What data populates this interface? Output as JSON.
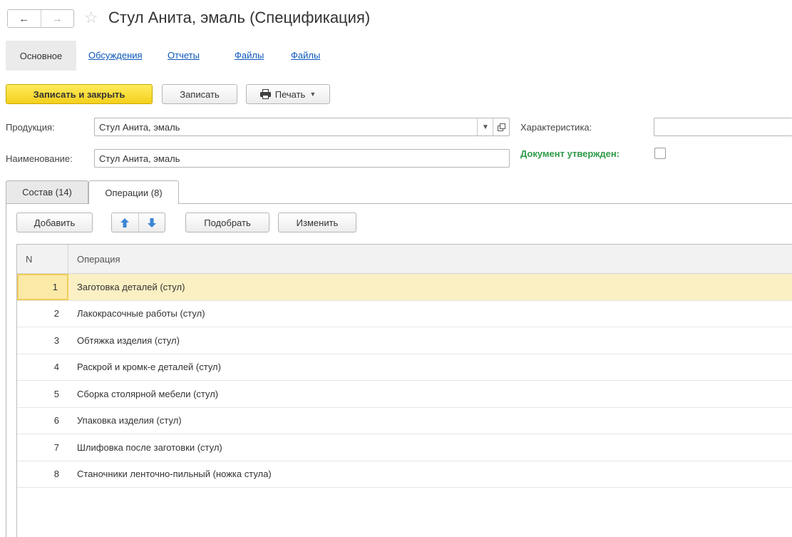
{
  "window": {
    "title": "Стул Анита, эмаль (Спецификация)",
    "nav_back": "←",
    "nav_forward": "→",
    "star": "☆"
  },
  "sections": [
    {
      "label": "Основное",
      "active": true
    },
    {
      "label": "Обсуждения"
    },
    {
      "label": "Отчеты"
    },
    {
      "label": "Файлы"
    },
    {
      "label": "Файлы"
    }
  ],
  "toolbar": {
    "save_close_label": "Записать и закрыть",
    "save_label": "Записать",
    "print_label": "Печать"
  },
  "form": {
    "product_label": "Продукция:",
    "product_value": "Стул Анита, эмаль",
    "characteristic_label": "Характеристика:",
    "characteristic_value": "",
    "name_label": "Наименование:",
    "name_value": "Стул Анита, эмаль",
    "approved_label": "Документ утвержден:",
    "approved_checked": false
  },
  "tabs": [
    {
      "label": "Состав (14)"
    },
    {
      "label": "Операции (8)",
      "active": true
    }
  ],
  "table_toolbar": {
    "add_label": "Добавить",
    "pick_label": "Подобрать",
    "edit_label": "Изменить"
  },
  "table": {
    "columns": [
      "N",
      "Операция"
    ],
    "rows": [
      {
        "n": "1",
        "operation": "Заготовка деталей (стул)"
      },
      {
        "n": "2",
        "operation": "Лакокрасочные работы (стул)"
      },
      {
        "n": "3",
        "operation": "Обтяжка изделия (стул)"
      },
      {
        "n": "4",
        "operation": "Раскрой и кромк-е деталей (стул)"
      },
      {
        "n": "5",
        "operation": "Сборка столярной мебели (стул)"
      },
      {
        "n": "6",
        "operation": "Упаковка изделия (стул)"
      },
      {
        "n": "7",
        "operation": "Шлифовка после заготовки (стул)"
      },
      {
        "n": "8",
        "operation": "Станочники ленточно-пильный (ножка стула)"
      }
    ],
    "selected_row": 0
  },
  "icons": {
    "printer": "printer-icon",
    "move_up": "arrow-up-icon",
    "move_down": "arrow-down-icon",
    "open_form": "open-form-icon",
    "dropdown": "dropdown-icon"
  },
  "colors": {
    "primary_button": "#f4cf1c",
    "link": "#0b57b8",
    "approved_text": "#2e9a46",
    "selected_row": "#fbf0c3",
    "arrow_blue": "#3a85d6"
  }
}
